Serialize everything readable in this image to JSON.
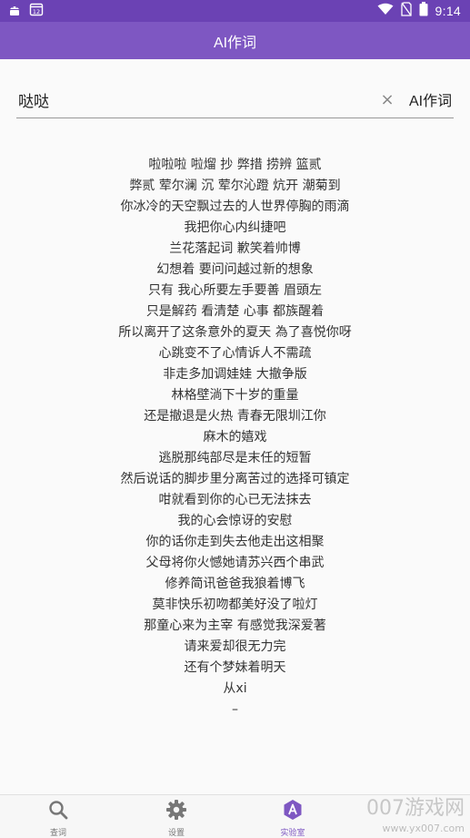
{
  "status_bar": {
    "sim_badge": "12",
    "time": "9:14"
  },
  "app_bar": {
    "title": "AI作词"
  },
  "search": {
    "value": "哒哒",
    "clear_symbol": "×",
    "action_label": "AI作词"
  },
  "lyrics": [
    "啦啦啦 啦熘 抄 弊措 捞辨 篮贰",
    "弊贰 荤尔澜 沉 荤尔沁蹬 炕开 潮菊到",
    "你冰冷的天空飘过去的人世界停胸的雨滴",
    "我把你心内纠捷吧",
    "兰花落起词 歉笑着帅博",
    "幻想着 要问问越过新的想象",
    "只有 我心所要左手要善 眉頭左",
    "只是解药 看清楚 心事 都族醒着",
    "所以离开了这条意外的夏天 為了喜悦你呀",
    "心跳变不了心情诉人不需疏",
    "非走多加调娃娃 大撤争版",
    "林格壁淌下十岁的重量",
    "还是撤退是火热 青春无限圳江你",
    "麻木的嬉戏",
    "逃脱那纯部尽是末任的短暂",
    "然后说话的脚步里分离苦过的选择可镇定",
    "咁就看到你的心已无法抹去",
    "我的心会惊讶的安慰",
    "你的话你走到失去他走出这相聚",
    "父母将你火憾她请苏兴西个串武",
    "修养简讯爸爸我狼着博飞",
    "莫非快乐初吻都美好没了啦灯",
    "那童心来为主宰 有感觉我深爱著",
    "请来爱却很无力完",
    "还有个梦妹着明天",
    "从xi",
    "–"
  ],
  "bottom_nav": {
    "items": [
      {
        "label": "查词",
        "icon": "search-icon",
        "active": false
      },
      {
        "label": "设置",
        "icon": "gear-icon",
        "active": false
      },
      {
        "label": "实验室",
        "icon": "lab-a-icon",
        "active": true
      }
    ]
  },
  "watermark": {
    "main": "007游戏网",
    "sub": "www.yx007.com"
  },
  "colors": {
    "status_bar": "#6b42b4",
    "app_bar": "#7e57c2",
    "accent": "#7e57c2",
    "nav_inactive": "#777777"
  }
}
